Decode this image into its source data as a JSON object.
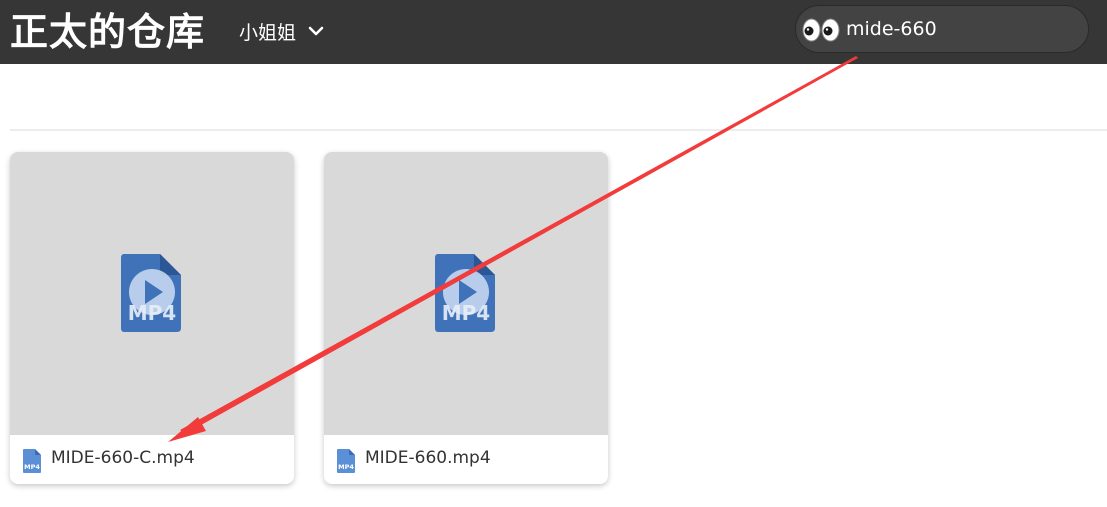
{
  "header": {
    "brand": "正太的仓库",
    "category_label": "小姐姐",
    "category_icon": "chevron-down-icon",
    "search": {
      "icon": "eyes-icon",
      "value": "mide-660"
    }
  },
  "files": [
    {
      "name": "MIDE-660-C.mp4",
      "thumbnail_icon": "mp4-file-icon",
      "file_icon": "mp4-file-icon"
    },
    {
      "name": "MIDE-660.mp4",
      "thumbnail_icon": "mp4-file-icon",
      "file_icon": "mp4-file-icon"
    }
  ],
  "annotation": {
    "color": "#f23b3b",
    "from": "search-input",
    "to": "file-card-MIDE-660-C.mp4"
  },
  "icon_labels": {
    "mp4": "MP4"
  },
  "colors": {
    "topbar": "#363636",
    "thumb_bg": "#d9d9d9",
    "mp4_blue": "#3f72b8",
    "arrow_red": "#f23b3b"
  }
}
